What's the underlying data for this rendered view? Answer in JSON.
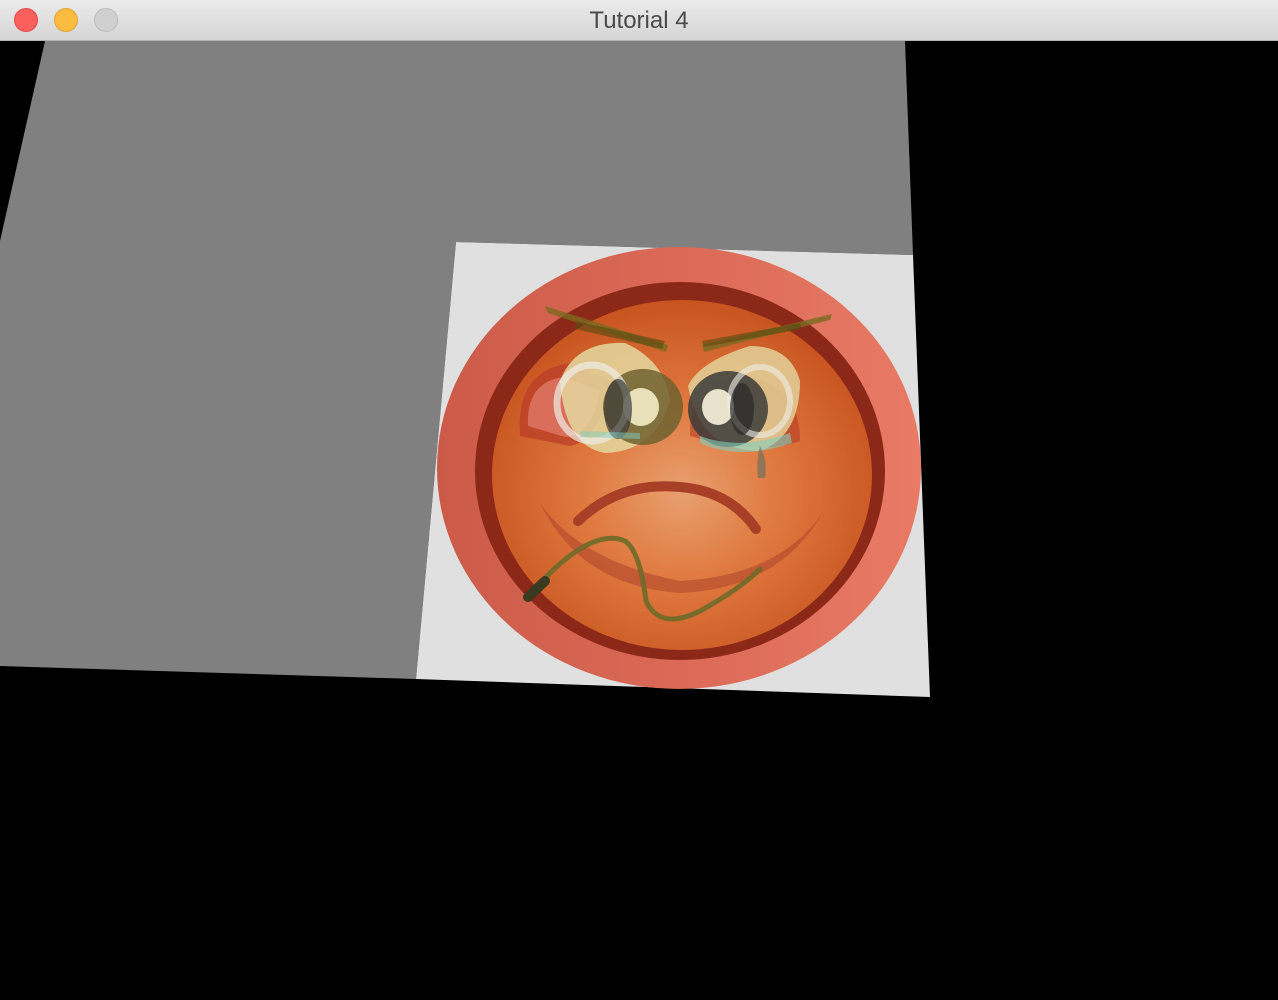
{
  "window": {
    "title": "Tutorial 4"
  },
  "colors": {
    "background": "#000000",
    "plane": "#808080",
    "texture_backdrop": "#e0e0e0",
    "face": "#e0683c",
    "face_rim": "#d9604c",
    "face_ring": "#8c2414"
  },
  "scene": {
    "description_icons": [
      "grey-plane",
      "textured-quad",
      "angry-smiley-texture"
    ]
  }
}
